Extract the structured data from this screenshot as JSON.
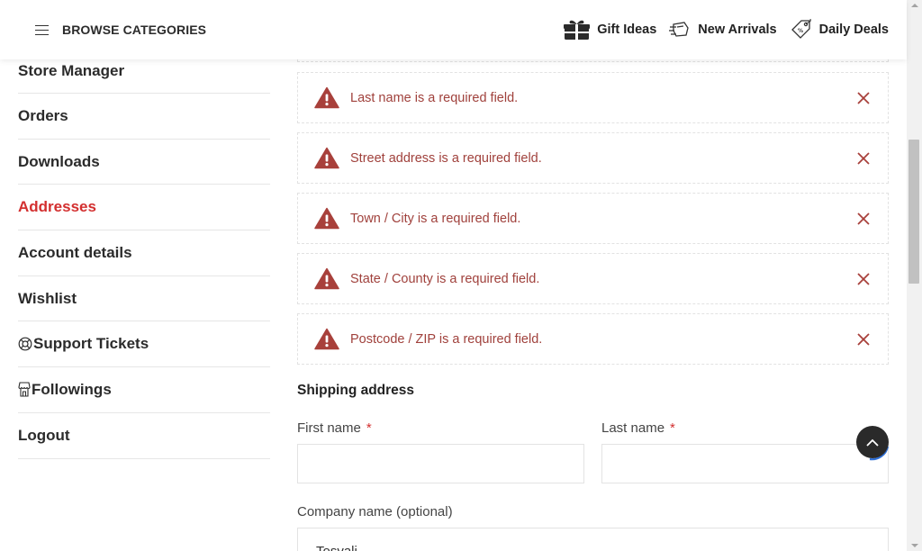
{
  "header": {
    "browse_label": "BROWSE CATEGORIES",
    "links": [
      {
        "label": "Gift Ideas",
        "icon": "gift-icon"
      },
      {
        "label": "New Arrivals",
        "icon": "delivery-icon"
      },
      {
        "label": "Daily Deals",
        "icon": "tag-icon"
      }
    ]
  },
  "sidebar": {
    "items": [
      {
        "label": "Store Manager"
      },
      {
        "label": "Orders"
      },
      {
        "label": "Downloads"
      },
      {
        "label": "Addresses",
        "active": true
      },
      {
        "label": "Account details"
      },
      {
        "label": "Wishlist"
      },
      {
        "label": "Support Tickets",
        "icon": "lifebuoy-icon"
      },
      {
        "label": "Followings",
        "icon": "storefront-icon"
      },
      {
        "label": "Logout"
      }
    ]
  },
  "notices": [
    "Last name is a required field.",
    "Street address is a required field.",
    "Town / City is a required field.",
    "State / County is a required field.",
    "Postcode / ZIP is a required field."
  ],
  "form": {
    "section_title": "Shipping address",
    "first_name_label": "First name",
    "first_name_value": "",
    "last_name_label": "Last name",
    "last_name_value": "",
    "required_mark": "*",
    "company_label": "Company name (optional)",
    "company_value": "Tosvali"
  },
  "colors": {
    "accent_red": "#d32f2f",
    "error_text": "#a0413c",
    "warning_icon": "#a8403b"
  }
}
